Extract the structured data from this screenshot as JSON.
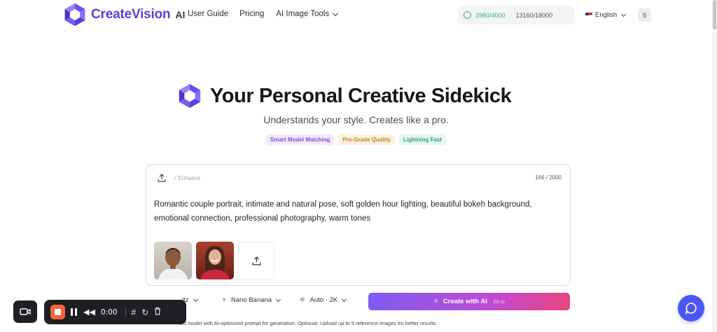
{
  "header": {
    "brand": "CreateVision",
    "brand_suffix": "AI",
    "nav": {
      "guide": "User Guide",
      "pricing": "Pricing",
      "tools": "AI Image Tools"
    },
    "credits": {
      "daily": "3980/4000",
      "separator": "·",
      "total": "13160/18000"
    },
    "language": "English",
    "avatar_initial": "S"
  },
  "hero": {
    "title": "Your Personal Creative Sidekick",
    "subtitle": "Understands your style. Creates like a pro.",
    "badges": [
      "Smart Model Matching",
      "Pro-Grade Quality",
      "Lightning Fast"
    ]
  },
  "prompt_card": {
    "enhance_label": "Enhance",
    "char_count": "166 / 2000",
    "prompt_text": "Romantic couple portrait, intimate and natural pose, soft golden hour lighting, beautiful bokeh background, emotional connection, professional photography, warm tones"
  },
  "toolbar": {
    "model_partial": "itz",
    "model2": "Nano Banana",
    "quality": "Auto · 2K",
    "create_label": "Create with AI",
    "create_cost": "· 20 cr"
  },
  "footnote": "red model with AI-optimized prompt for generation. Optional: Upload up to 5 reference images for better results.",
  "recorder": {
    "time": "0:00"
  },
  "colors": {
    "brand": "#5b3fd6",
    "accent_green": "#3fb36c",
    "button_gradient_start": "#7b5cf0",
    "button_gradient_end": "#e8467f",
    "chat_blue": "#4a57f0",
    "record_orange": "#f2643a"
  },
  "icons": [
    "logo-mark-icon",
    "lock-icon",
    "flag-icon",
    "upload-icon",
    "wand-icon",
    "sparkle-icon",
    "camera-icon",
    "chat-icon",
    "grid-icon",
    "reset-icon",
    "trash-icon"
  ]
}
